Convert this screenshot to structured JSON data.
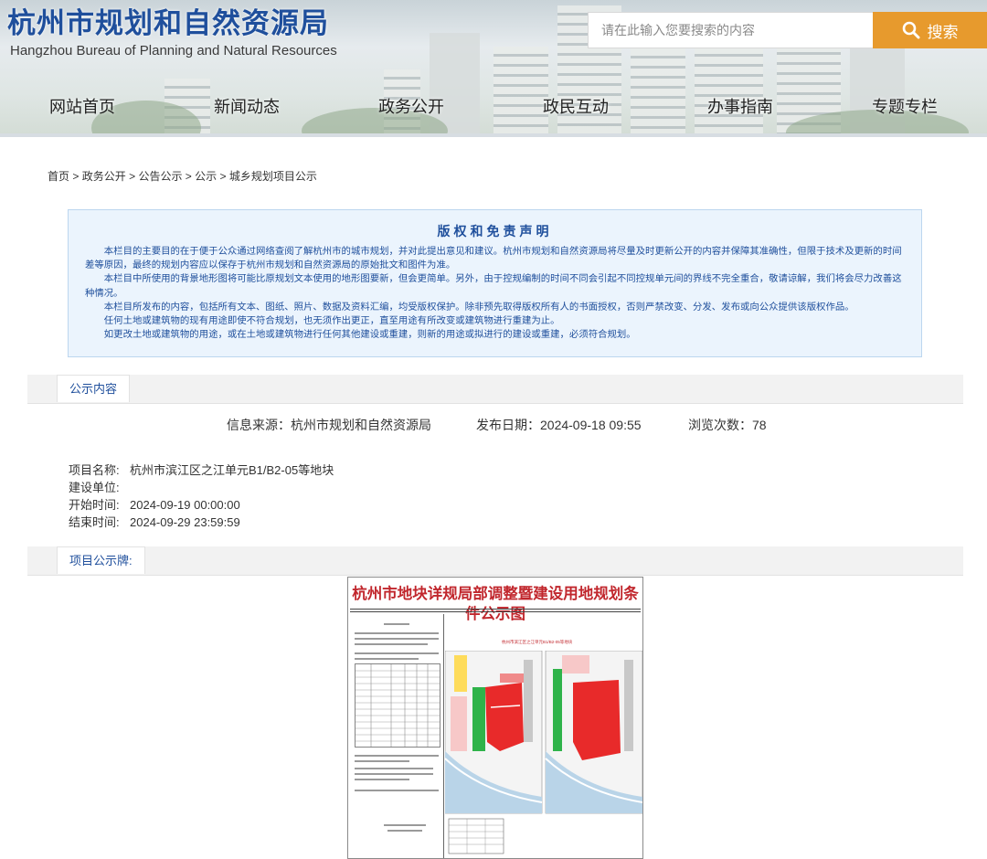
{
  "header": {
    "title": "杭州市规划和自然资源局",
    "subtitle": "Hangzhou Bureau of Planning and Natural Resources",
    "search_placeholder": "请在此输入您要搜索的内容",
    "search_button": "搜索"
  },
  "nav": [
    "网站首页",
    "新闻动态",
    "政务公开",
    "政民互动",
    "办事指南",
    "专题专栏"
  ],
  "breadcrumb": [
    "首页",
    "政务公开",
    "公告公示",
    "公示",
    "城乡规划项目公示"
  ],
  "breadcrumb_separator": ">",
  "disclaimer": {
    "title": "版权和免责声明",
    "paragraphs": [
      "本栏目的主要目的在于便于公众通过网络查阅了解杭州市的城市规划，并对此提出意见和建议。杭州市规划和自然资源局将尽量及时更新公开的内容并保障其准确性，但限于技术及更新的时间差等原因，最终的规划内容应以保存于杭州市规划和自然资源局的原始批文和图件为准。",
      "本栏目中所使用的背景地形图将可能比原规划文本使用的地形图要新，但会更简单。另外，由于控规编制的时间不同会引起不同控规单元间的界线不完全重合，敬请谅解，我们将会尽力改善这种情况。",
      "本栏目所发布的内容，包括所有文本、图纸、照片、数据及资料汇编，均受版权保护。除非预先取得版权所有人的书面授权，否则严禁改变、分发、发布或向公众提供该版权作品。",
      "任何土地或建筑物的现有用途即使不符合规划，也无须作出更正，直至用途有所改变或建筑物进行重建为止。",
      "如更改土地或建筑物的用途，或在土地或建筑物进行任何其他建设或重建，则新的用途或拟进行的建设或重建，必须符合规划。"
    ]
  },
  "content_section": {
    "tab": "公示内容",
    "source": "信息来源：杭州市规划和自然资源局",
    "publish_date": "发布日期：2024-09-18 09:55",
    "views": "浏览次数：78"
  },
  "project": {
    "name_label": "项目名称:",
    "name_value": "杭州市滨江区之江单元B1/B2-05等地块",
    "unit_label": "建设单位:",
    "unit_value": "",
    "start_label": "开始时间:",
    "start_value": "2024-09-19 00:00:00",
    "end_label": "结束时间:",
    "end_value": "2024-09-29 23:59:59"
  },
  "board_section": {
    "tab": "项目公示牌:",
    "board_title": "杭州市地块详规局部调整暨建设用地规划条件公示图",
    "map_caption": "杭州市滨江区之江单元B1/B2-05等地块"
  },
  "colors": {
    "brand_blue": "#1f4f9c",
    "search_orange": "#e79a2d",
    "board_red": "#c1272d",
    "plot_red": "#e82a2a"
  }
}
